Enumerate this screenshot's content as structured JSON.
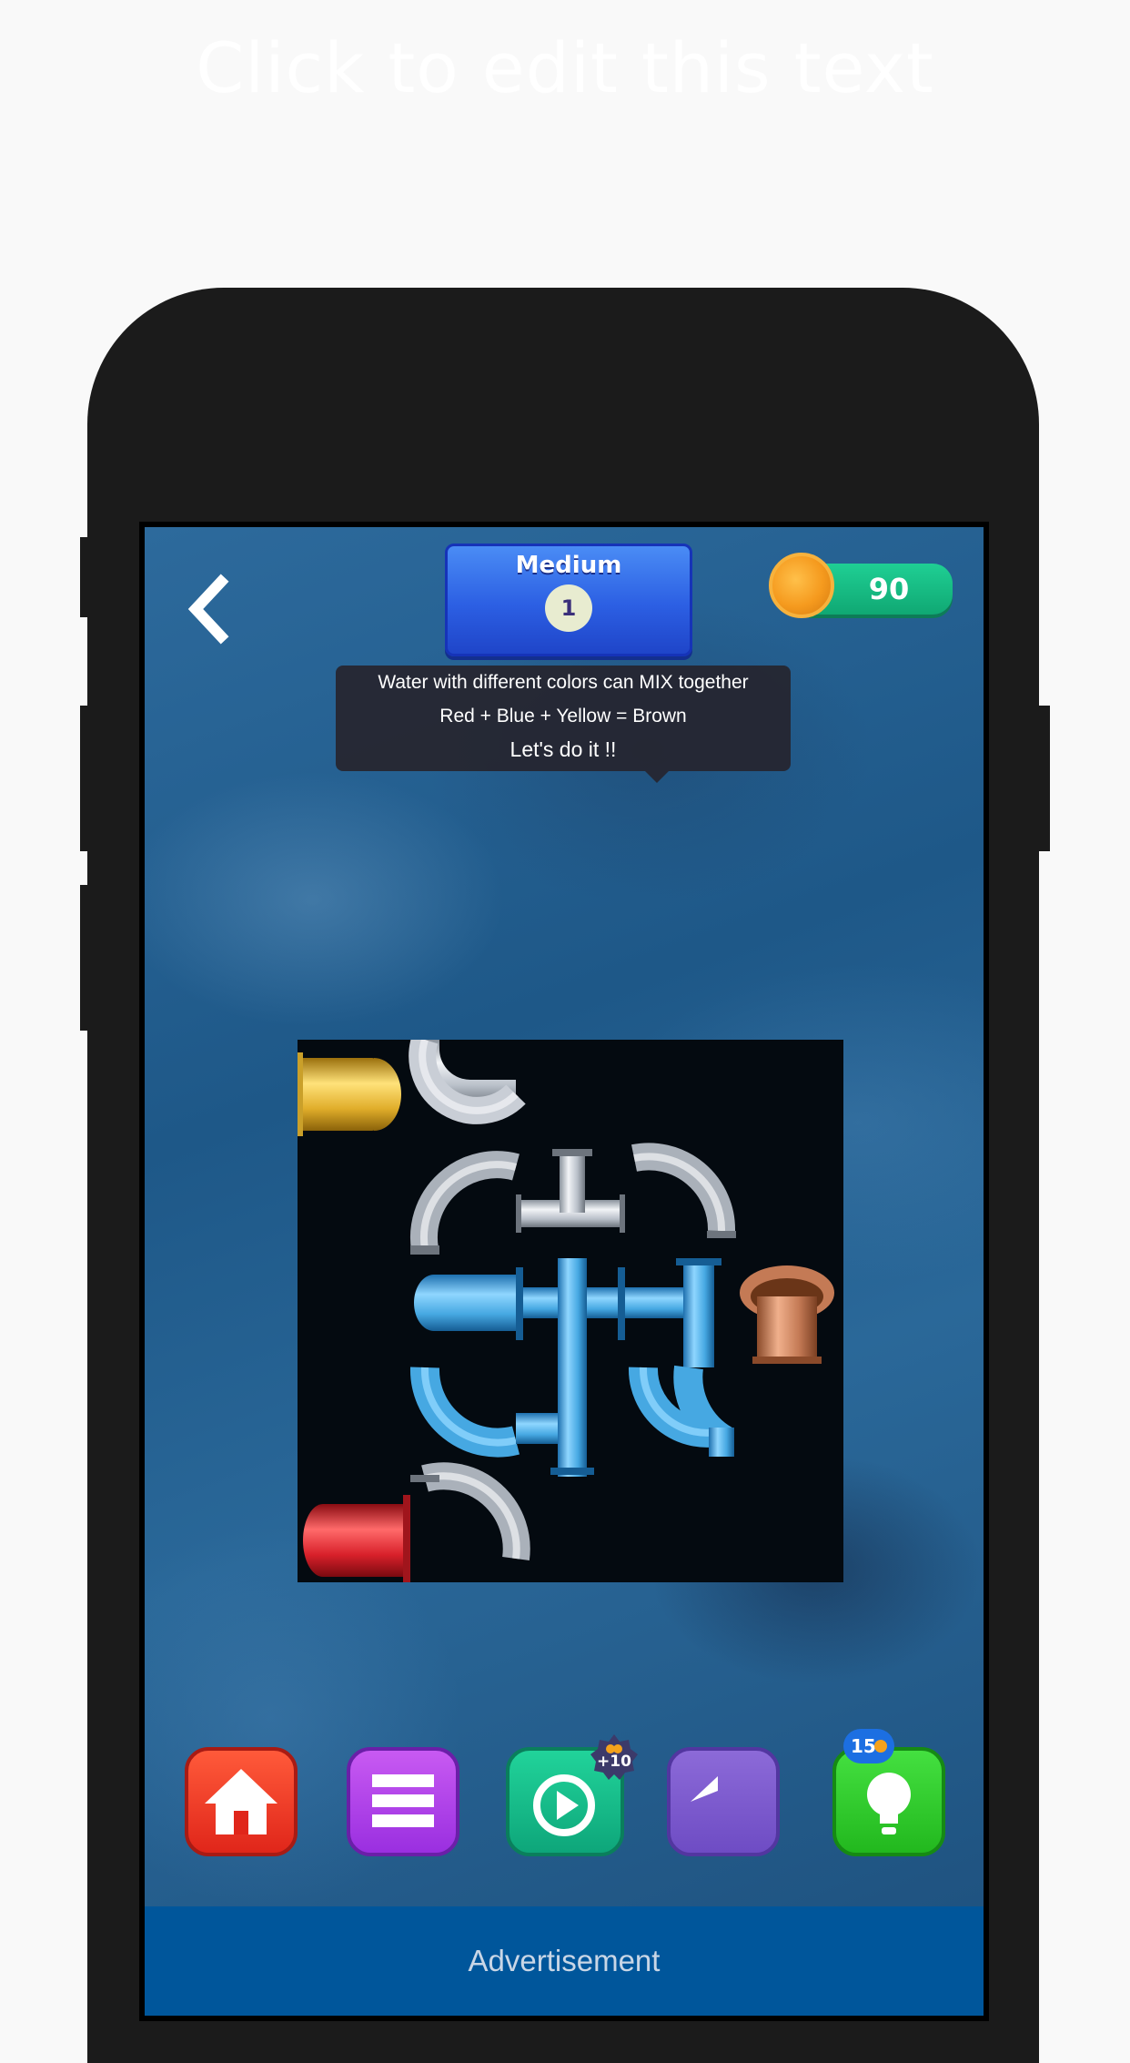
{
  "page": {
    "headline": "Click to edit this text"
  },
  "hud": {
    "difficulty": "Medium",
    "level": "1",
    "coins": "90"
  },
  "tooltip": {
    "line1": "Water with different colors can MIX together",
    "line2": "Red + Blue + Yellow = Brown",
    "line3": "Let's do it !!"
  },
  "toolbar": {
    "home_icon": "home-icon",
    "menu_icon": "menu-icon",
    "video_icon": "play-video-icon",
    "video_reward": "+10",
    "undo_icon": "undo-icon",
    "hint_icon": "lightbulb-icon",
    "hint_count": "15"
  },
  "ad": {
    "label": "Advertisement"
  },
  "colors": {
    "yellow_source": "#e3b22c",
    "red_source": "#d8202a",
    "brown_target": "#c47a55",
    "water_blue": "#4ab0e8",
    "empty_pipe": "#c9ced6"
  }
}
